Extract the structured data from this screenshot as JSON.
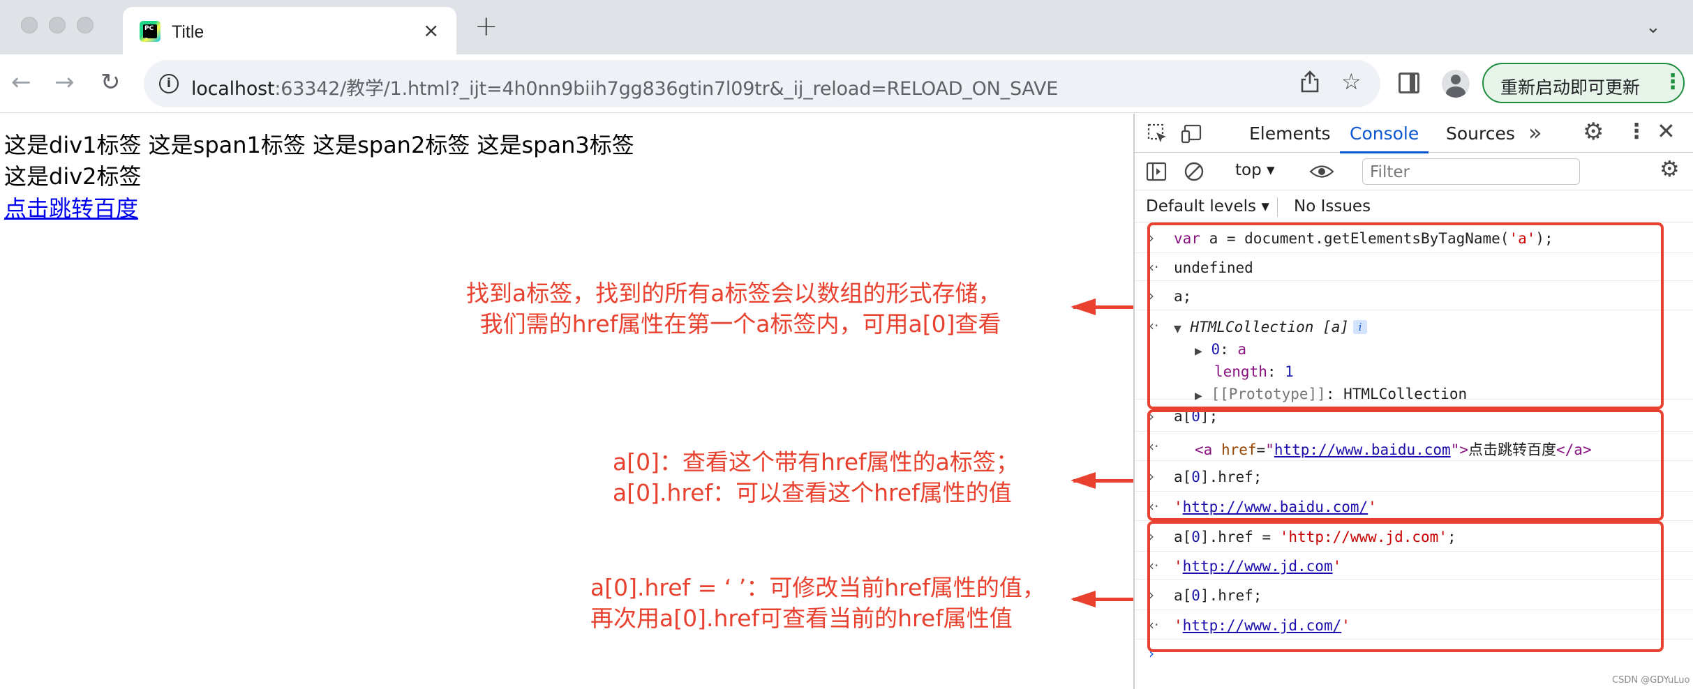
{
  "browser": {
    "tab_title": "Title",
    "tab_close": "×",
    "new_tab": "+",
    "tab_search": "⌄",
    "url_host": "localhost",
    "url_rest": ":63342/教学/1.html?_ijt=4h0nn9biih7gg836gtin7l09tr&_ij_reload=RELOAD_ON_SAVE",
    "update_label": "重新启动即可更新"
  },
  "page": {
    "line1": "这是div1标签 这是span1标签 这是span2标签 这是span3标签",
    "line2": "这是div2标签",
    "link_text": "点击跳转百度"
  },
  "devtools": {
    "tabs": [
      "Elements",
      "Console",
      "Sources"
    ],
    "active_tab": "Console",
    "context": "top",
    "filter_placeholder": "Filter",
    "levels": "Default levels",
    "issues": "No Issues"
  },
  "console": {
    "cmd1": "var a = document.getElementsByTagName('a');",
    "res1": "undefined",
    "cmd2": "a;",
    "collection": "HTMLCollection",
    "collection_tag": "[a]",
    "item0_key": "0",
    "item0_val": "a",
    "length_key": "length",
    "length_val": "1",
    "proto_key": "[[Prototype]]",
    "proto_val": "HTMLCollection",
    "cmd3": "a[0];",
    "elem_href": "http://www.baidu.com",
    "elem_text": "点击跳转百度",
    "cmd4": "a[0].href;",
    "res4": "http://www.baidu.com/",
    "cmd5": "a[0].href = 'http://www.jd.com';",
    "res5": "http://www.jd.com",
    "cmd6": "a[0].href;",
    "res6": "http://www.jd.com/"
  },
  "annotations": {
    "a1_line1": "找到a标签，找到的所有a标签会以数组的形式存储，",
    "a1_line2": "我们需的href属性在第一个a标签内，可用a[0]查看",
    "a2_line1": "a[0]：查看这个带有href属性的a标签；",
    "a2_line2": "a[0].href：可以查看这个href属性的值",
    "a3_line1": "a[0].href = ‘ ’：可修改当前href属性的值，",
    "a3_line2": "再次用a[0].href可查看当前的href属性值"
  },
  "watermark": "CSDN @GDYuLuo",
  "colors": {
    "annotation": "#e8412f",
    "devtools_accent": "#0b57d0",
    "update_green": "#1e8e3e"
  }
}
